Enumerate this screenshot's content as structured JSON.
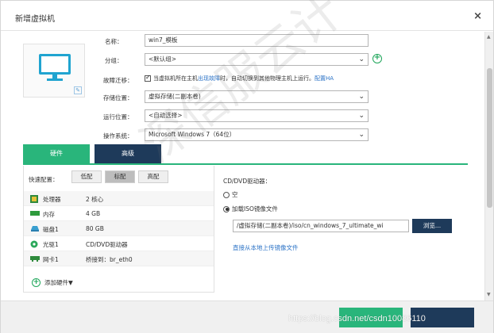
{
  "dialog": {
    "title": "新增虚拟机",
    "close_glyph": "×"
  },
  "form": {
    "name_label": "名称：",
    "name_value": "win7_模板",
    "group_label": "分组：",
    "group_value": "<默认组>",
    "ha_label": "故障迁移：",
    "ha_text_1": "当虚拟机所在主机",
    "ha_link_1": "出现故障",
    "ha_text_2": "时，自动切换到其他物理主机上运行。",
    "ha_link_2": "配置HA",
    "storage_label": "存储位置：",
    "storage_value": "虚拟存储(二副本卷)",
    "runloc_label": "运行位置：",
    "runloc_value": "<自动选择>",
    "os_label": "操作系统：",
    "os_value": "Microsoft Windows 7（64位）"
  },
  "tabs": {
    "hardware": "硬件",
    "advanced": "高级"
  },
  "quick_config": {
    "label": "快速配置：",
    "options": [
      "低配",
      "标配",
      "高配"
    ],
    "selected": "标配"
  },
  "hardware": [
    {
      "name": "处理器",
      "value": "2 核心",
      "icon": "cpu-icon"
    },
    {
      "name": "内存",
      "value": "4 GB",
      "icon": "memory-icon"
    },
    {
      "name": "磁盘1",
      "value": "80 GB",
      "icon": "disk-icon"
    },
    {
      "name": "光驱1",
      "value": "CD/DVD驱动器",
      "icon": "cdrom-icon"
    },
    {
      "name": "网卡1",
      "value": "桥接到：br_eth0",
      "icon": "nic-icon"
    }
  ],
  "add_hardware": "添加硬件▼",
  "cd": {
    "title": "CD/DVD驱动器：",
    "option_empty": "空",
    "option_iso": "加载ISO镜像文件",
    "iso_path": "/虚拟存储(二副本卷)/iso/cn_windows_7_ultimate_wi",
    "browse": "浏览...",
    "upload_link": "直接从本地上传镜像文件"
  },
  "footer": {
    "watermark": "https://blog.csdn.net/csdn10086110"
  },
  "overlay_watermark": "深信服云计",
  "colors": {
    "green": "#29b57b",
    "navy": "#1e3a5a",
    "link": "#2a72c6"
  }
}
